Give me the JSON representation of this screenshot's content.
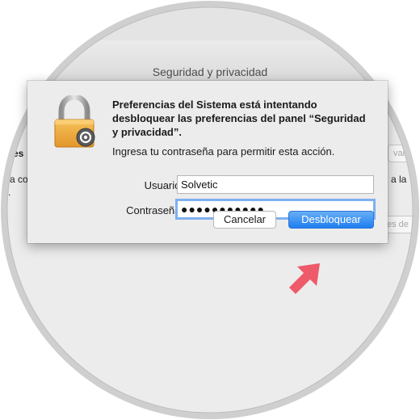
{
  "window": {
    "title": "Seguridad y privacidad",
    "background_fragments": {
      "left_label": "es",
      "left_text": "a co",
      "left_dot": ".",
      "right_button_1": "var",
      "right_text": "a la",
      "right_button_2": "es de"
    }
  },
  "dialog": {
    "title": "Preferencias del Sistema está intentando desbloquear las preferencias del panel “Seguridad y privacidad”.",
    "subtitle": "Ingresa tu contraseña para permitir esta acción.",
    "username_label": "Usuario:",
    "username_value": "Solvetic",
    "password_label": "Contraseña:",
    "password_value": "●●●●●●●●●●●",
    "cancel_label": "Cancelar",
    "unlock_label": "Desbloquear",
    "lock_icon": "padlock-icon"
  },
  "colors": {
    "accent": "#2a80f0",
    "arrow": "#ee5a6a",
    "focus_ring": "#7fb0ef"
  }
}
